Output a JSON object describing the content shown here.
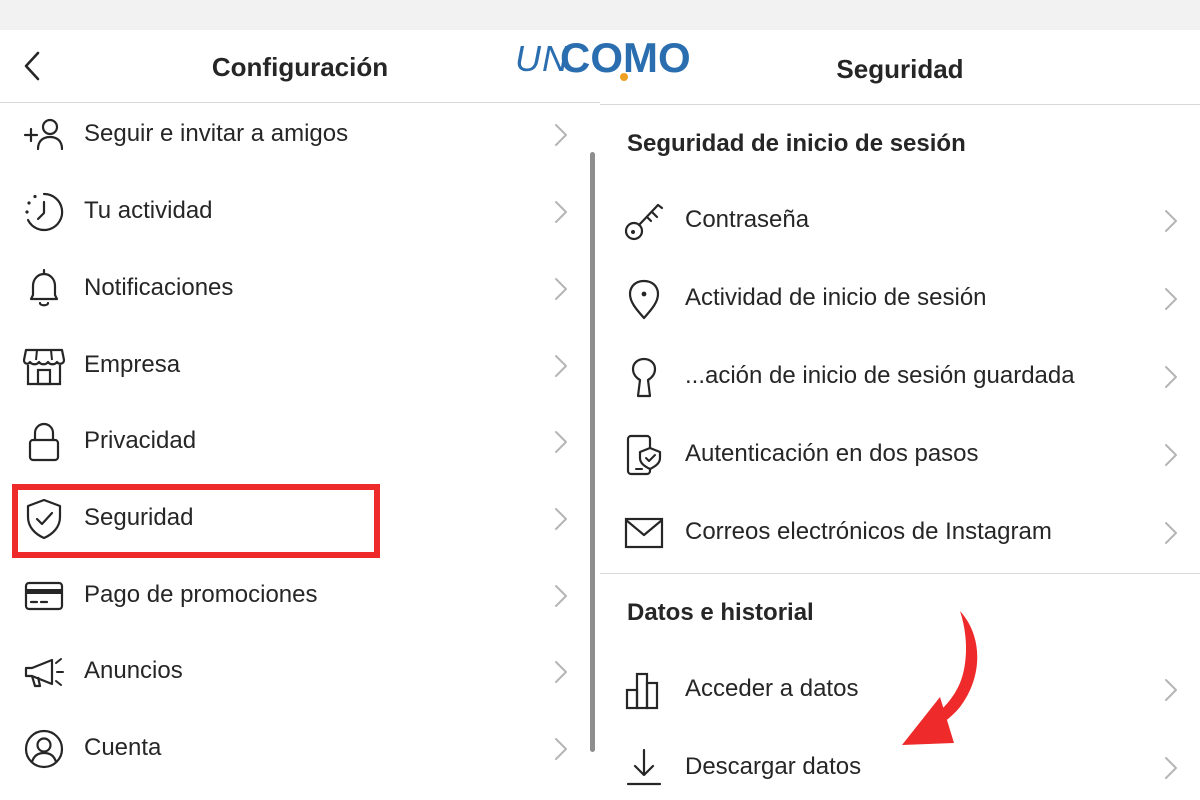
{
  "brand": {
    "logo_un": "UN",
    "logo_como": "COMO",
    "accent_color": "#2a6eb0",
    "highlight_color": "#ee2a2a"
  },
  "left": {
    "title": "Configuración",
    "items": [
      {
        "label": "Seguir e invitar a amigos",
        "icon": "add-person-icon"
      },
      {
        "label": "Tu actividad",
        "icon": "activity-clock-icon"
      },
      {
        "label": "Notificaciones",
        "icon": "bell-icon"
      },
      {
        "label": "Empresa",
        "icon": "shop-icon"
      },
      {
        "label": "Privacidad",
        "icon": "lock-icon"
      },
      {
        "label": "Seguridad",
        "icon": "shield-check-icon"
      },
      {
        "label": "Pago de promociones",
        "icon": "credit-card-icon"
      },
      {
        "label": "Anuncios",
        "icon": "megaphone-icon"
      },
      {
        "label": "Cuenta",
        "icon": "user-circle-icon"
      }
    ]
  },
  "right": {
    "title": "Seguridad",
    "section1": "Seguridad de inicio de sesión",
    "section1_items": [
      {
        "label": "Contraseña",
        "icon": "key-icon"
      },
      {
        "label": "Actividad de inicio de sesión",
        "icon": "location-pin-icon"
      },
      {
        "label": "...ación de inicio de sesión guardada",
        "icon": "keyhole-icon"
      },
      {
        "label": "Autenticación en dos pasos",
        "icon": "phone-shield-icon"
      },
      {
        "label": "Correos electrónicos de Instagram",
        "icon": "envelope-icon"
      }
    ],
    "section2": "Datos e historial",
    "section2_items": [
      {
        "label": "Acceder a datos",
        "icon": "bar-chart-icon"
      },
      {
        "label": "Descargar datos",
        "icon": "download-icon"
      }
    ]
  }
}
